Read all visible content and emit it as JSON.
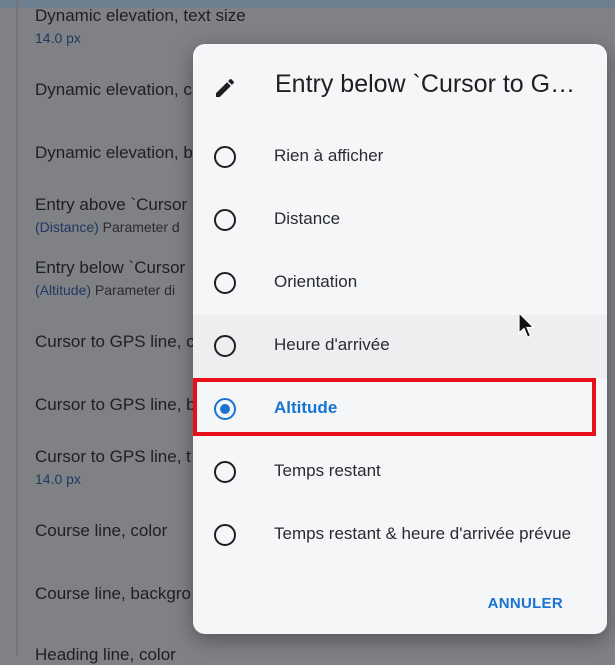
{
  "background_list": {
    "items": [
      {
        "title": "Dynamic elevation, text size",
        "value": "14.0 px"
      },
      {
        "title": "Dynamic elevation, c"
      },
      {
        "title": "Dynamic elevation, b"
      },
      {
        "title": "Entry above `Cursor",
        "sub_accent": "(Distance)",
        "sub_rest": " Parameter d"
      },
      {
        "title": "Entry below `Cursor",
        "sub_accent": "(Altitude)",
        "sub_rest": " Parameter di"
      },
      {
        "title": "Cursor to GPS line, c"
      },
      {
        "title": "Cursor to GPS line, b"
      },
      {
        "title": "Cursor to GPS line, t",
        "value": "14.0 px"
      },
      {
        "title": "Course line, color"
      },
      {
        "title": "Course line, backgro"
      },
      {
        "title": "Heading line, color"
      }
    ]
  },
  "dialog": {
    "icon": "pencil-icon",
    "title": "Entry below `Cursor to G…",
    "options": [
      {
        "label": "Rien à afficher",
        "checked": false
      },
      {
        "label": "Distance",
        "checked": false
      },
      {
        "label": "Orientation",
        "checked": false
      },
      {
        "label": "Heure d'arrivée",
        "checked": false
      },
      {
        "label": "Altitude",
        "checked": true
      },
      {
        "label": "Temps restant",
        "checked": false
      },
      {
        "label": "Temps restant & heure d'arrivée prévue",
        "checked": false
      }
    ],
    "cancel_label": "ANNULER"
  },
  "colors": {
    "accent": "#1a73d1",
    "highlight_box": "#e8101a",
    "dialog_bg": "#f4f6f8"
  }
}
